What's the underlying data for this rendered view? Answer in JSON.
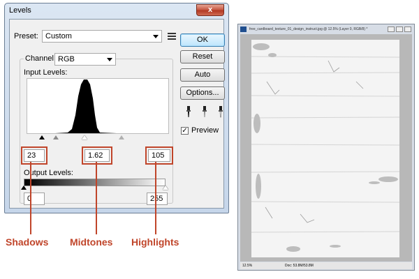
{
  "dialog": {
    "title": "Levels",
    "close_glyph": "x",
    "preset_label": "Preset:",
    "preset_value": "Custom",
    "channel_label": "Channel:",
    "channel_value": "RGB",
    "input_levels_label": "Input Levels:",
    "output_levels_label": "Output Levels:",
    "input_shadow": "23",
    "input_midtone": "1.62",
    "input_highlight": "105",
    "output_low": "0",
    "output_high": "255",
    "buttons": {
      "ok": "OK",
      "reset": "Reset",
      "auto": "Auto",
      "options": "Options..."
    },
    "preview_label": "Preview",
    "preview_checked": true,
    "check_glyph": "✓"
  },
  "callouts": {
    "shadows": "Shadows",
    "midtones": "Midtones",
    "highlights": "Highlights",
    "color": "#c0452a"
  },
  "image_window": {
    "title": "free_cardboard_texture_01_design_instruct.jpg @ 12.5% (Layer 0, RGB/8) *",
    "zoom": "12.5%",
    "doc_info": "Doc: 53.8M/53.8M"
  },
  "icons": [
    "close-icon",
    "dropdown-arrow-icon",
    "preset-menu-icon",
    "black-eyedropper-icon",
    "gray-eyedropper-icon",
    "white-eyedropper-icon"
  ]
}
